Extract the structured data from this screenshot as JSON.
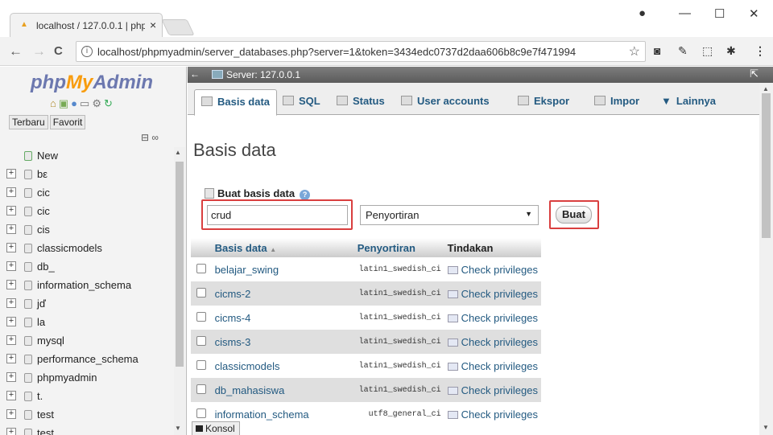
{
  "browser": {
    "tab_title": "localhost / 127.0.0.1 | php",
    "tab_close": "×",
    "url": "localhost/phpmyadmin/server_databases.php?server=1&token=3434edc0737d2daa606b8c9e7f471994",
    "controls": {
      "minimize": "—",
      "maximize": "☐",
      "close": "✕",
      "profile": "●"
    },
    "nav": {
      "back": "←",
      "forward": "→",
      "reload": "C"
    }
  },
  "sidebar": {
    "logo_php": "php",
    "logo_my": "My",
    "logo_admin": "Admin",
    "recent": "Terbaru",
    "favorites": "Favorit",
    "new_label": "New",
    "databases": [
      "bε",
      "cic",
      "cic",
      "cis",
      "classicmodels",
      "db_",
      "information_schema",
      "jď",
      "la",
      "mysql",
      "performance_schema",
      "phpmyadmin",
      "t.",
      "test",
      "test"
    ]
  },
  "server_bar": {
    "label": "Server: 127.0.0.1"
  },
  "tabs": [
    {
      "label": "Basis data"
    },
    {
      "label": "SQL"
    },
    {
      "label": "Status"
    },
    {
      "label": "User accounts"
    },
    {
      "label": "Ekspor"
    },
    {
      "label": "Impor"
    },
    {
      "label": "Lainnya"
    }
  ],
  "page": {
    "title": "Basis data"
  },
  "create_db": {
    "label": "Buat basis data",
    "name_value": "crud",
    "collation_value": "Penyortiran",
    "button": "Buat"
  },
  "table": {
    "headers": {
      "name": "Basis data",
      "collation": "Penyortiran",
      "action": "Tindakan"
    },
    "rows": [
      {
        "name": "belajar_swing",
        "collation": "latin1_swedish_ci",
        "action": "Check privileges"
      },
      {
        "name": "cicms-2",
        "collation": "latin1_swedish_ci",
        "action": "Check privileges"
      },
      {
        "name": "cicms-4",
        "collation": "latin1_swedish_ci",
        "action": "Check privileges"
      },
      {
        "name": "cisms-3",
        "collation": "latin1_swedish_ci",
        "action": "Check privileges"
      },
      {
        "name": "classicmodels",
        "collation": "latin1_swedish_ci",
        "action": "Check privileges"
      },
      {
        "name": "db_mahasiswa",
        "collation": "latin1_swedish_ci",
        "action": "Check privileges"
      },
      {
        "name": "information_schema",
        "collation": "utf8_general_ci",
        "action": "Check privileges"
      }
    ]
  },
  "console": {
    "label": "Konsol"
  },
  "colors": {
    "link": "#235a81",
    "highlight": "#d93f3f",
    "logo_blue": "#6c78af",
    "logo_orange": "#f89c0e"
  }
}
